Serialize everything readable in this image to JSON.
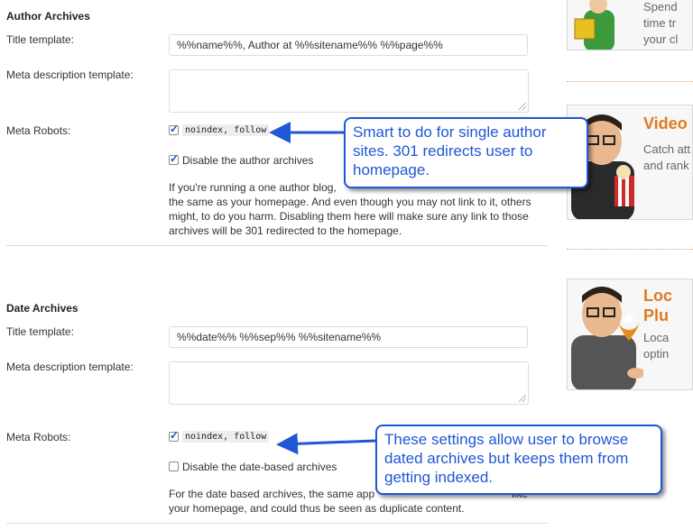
{
  "author_section": {
    "heading": "Author Archives",
    "title_label": "Title template:",
    "title_value": "%%name%%, Author at %%sitename%% %%page%%",
    "meta_desc_label": "Meta description template:",
    "robots_label": "Meta Robots:",
    "robots_value": "noindex, follow",
    "robots_checked": true,
    "disable_label": "Disable the author archives",
    "disable_checked": true,
    "help_line1": "If you're running a one author blog, ",
    "help_line2": "the same as your homepage. And even though you may not link to it, others",
    "help_line3": "might, to do you harm. Disabling them here will make sure any link to those",
    "help_line4": "archives will be 301 redirected to the homepage."
  },
  "date_section": {
    "heading": "Date Archives",
    "title_label": "Title template:",
    "title_value": "%%date%% %%sep%% %%sitename%%",
    "meta_desc_label": "Meta description template:",
    "robots_label": "Meta Robots:",
    "robots_value": "noindex, follow",
    "robots_checked": true,
    "disable_label": "Disable the date-based archives",
    "disable_checked": false,
    "help_line1": "For the date based archives, the same app",
    "help_line1_tail": "like",
    "help_line2": "your homepage, and could thus be seen as duplicate content."
  },
  "callouts": {
    "author": "Smart to do for single author sites. 301 redirects user to homepage.",
    "date": "These settings allow user to browse dated archives but keeps them from getting indexed."
  },
  "sidebar": {
    "ad1_line1": "Spend",
    "ad1_line2": "time tr",
    "ad1_line3": "your cl",
    "ad2_title": "Video",
    "ad2_line1": "Catch att",
    "ad2_line2": "and rank",
    "ad3_title1": "Loc",
    "ad3_title2": "Plu",
    "ad3_line1": "Loca",
    "ad3_line2": "optin"
  },
  "colors": {
    "callout_blue": "#1f57d6",
    "accent_orange": "#e07a1f"
  }
}
